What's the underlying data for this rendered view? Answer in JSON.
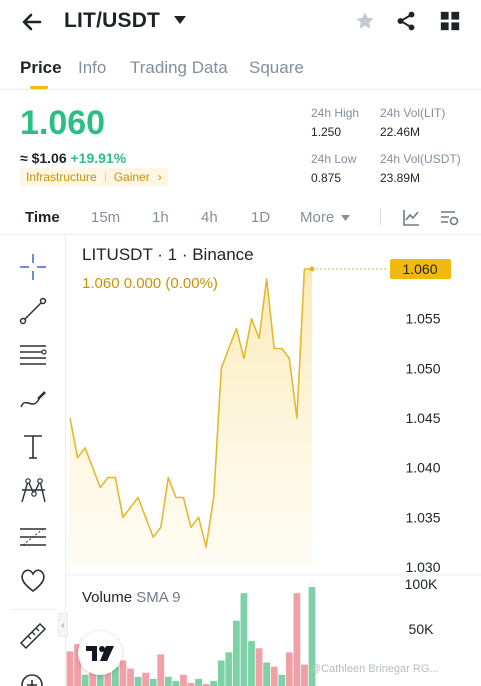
{
  "header": {
    "pair": "LIT/USDT",
    "icons": [
      "back-arrow-icon",
      "caret-down-icon",
      "star-icon",
      "share-icon",
      "grid-icon"
    ]
  },
  "tabs": [
    "Price",
    "Info",
    "Trading Data",
    "Square"
  ],
  "active_tab": "Price",
  "price": {
    "last": "1.060",
    "approx": "≈ $1.06",
    "change": "+19.91%",
    "tags": [
      "Infrastructure",
      "Gainer"
    ],
    "color": "#2ebd85"
  },
  "stats": {
    "high_label": "24h High",
    "high": "1.250",
    "low_label": "24h Low",
    "low": "0.875",
    "vol_base_label": "24h Vol(LIT)",
    "vol_base": "22.46M",
    "vol_quote_label": "24h Vol(USDT)",
    "vol_quote": "23.89M"
  },
  "intervals": [
    "Time",
    "15m",
    "1h",
    "4h",
    "1D",
    "More"
  ],
  "active_interval": "Time",
  "chart": {
    "title": "LITUSDT · 1 · Binance",
    "ohlc": "1.060  0.000 (0.00%)",
    "price_tag": "1.060",
    "volume_title": "Volume",
    "volume_sma": "SMA 9",
    "watermark": "@Cathleen Brinegar RG..."
  },
  "chart_data": {
    "type": "area",
    "series": [
      {
        "values": [
          1.045,
          1.041,
          1.042,
          1.04,
          1.038,
          1.039,
          1.039,
          1.035,
          1.036,
          1.037,
          1.035,
          1.033,
          1.034,
          1.039,
          1.037,
          1.037,
          1.034,
          1.035,
          1.032,
          1.037,
          1.05,
          1.052,
          1.054,
          1.051,
          1.055,
          1.053,
          1.059,
          1.052,
          1.052,
          1.051,
          1.045,
          1.06,
          1.06
        ]
      }
    ],
    "y_ticks": [
      "1.060",
      "1.055",
      "1.050",
      "1.045",
      "1.040",
      "1.035",
      "1.030"
    ],
    "ylim": [
      1.03,
      1.06
    ],
    "volume": {
      "y_ticks": [
        "100K",
        "50K"
      ],
      "ylim": [
        0,
        100000
      ],
      "values": [
        35,
        42,
        12,
        28,
        15,
        22,
        20,
        26,
        18,
        10,
        14,
        8,
        32,
        10,
        6,
        12,
        4,
        8,
        3,
        6,
        26,
        34,
        65,
        92,
        45,
        38,
        24,
        20,
        12,
        34,
        92,
        22,
        98
      ],
      "up": [
        false,
        false,
        true,
        false,
        true,
        false,
        true,
        false,
        false,
        true,
        false,
        true,
        false,
        true,
        true,
        false,
        false,
        true,
        false,
        true,
        true,
        true,
        true,
        true,
        true,
        false,
        true,
        false,
        true,
        false,
        false,
        false,
        true
      ],
      "up_color": "#7ed1a6",
      "down_color": "#f2a0a8"
    }
  }
}
